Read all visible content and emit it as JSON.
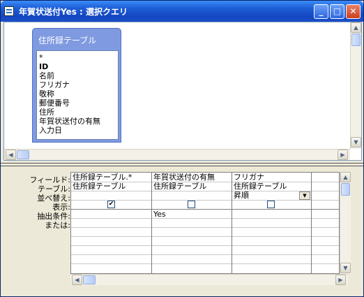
{
  "window": {
    "title": "年賀状送付Yes : 選択クエリ",
    "minimize": "_",
    "maximize": "□",
    "close": "✕"
  },
  "table": {
    "title": "住所録テーブル",
    "fields": [
      "*",
      "ID",
      "名前",
      "フリガナ",
      "敬称",
      "郵便番号",
      "住所",
      "年賀状送付の有無",
      "入力日"
    ]
  },
  "grid": {
    "row_labels": [
      "フィールド:",
      "テーブル:",
      "並べ替え:",
      "表示:",
      "抽出条件:",
      "または:"
    ],
    "columns": [
      {
        "field": "住所録テーブル.*",
        "table": "住所録テーブル",
        "sort": "",
        "show": "✔",
        "criteria": ""
      },
      {
        "field": "年賀状送付の有無",
        "table": "住所録テーブル",
        "sort": "",
        "show": "",
        "criteria": "Yes"
      },
      {
        "field": "フリガナ",
        "table": "住所録テーブル",
        "sort": "昇順",
        "show": "",
        "criteria": ""
      }
    ],
    "dropdown_icon": "▼"
  },
  "scroll": {
    "up": "▲",
    "down": "▼",
    "left": "◀",
    "right": "▶"
  }
}
